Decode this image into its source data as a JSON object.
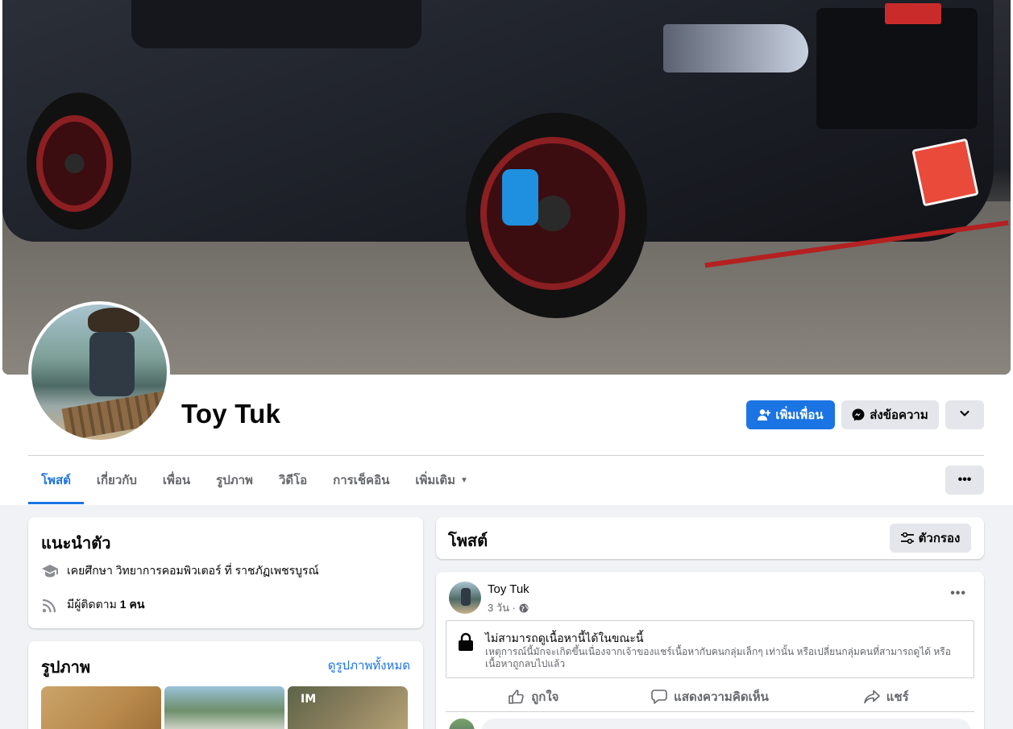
{
  "profile": {
    "name": "Toy Tuk",
    "add_friend_label": "เพิ่มเพื่อน",
    "message_label": "ส่งข้อความ"
  },
  "tabs": [
    {
      "label": "โพสต์",
      "active": true
    },
    {
      "label": "เกี่ยวกับ"
    },
    {
      "label": "เพื่อน"
    },
    {
      "label": "รูปภาพ"
    },
    {
      "label": "วิดีโอ"
    },
    {
      "label": "การเช็คอิน"
    },
    {
      "label": "เพิ่มเติม"
    }
  ],
  "intro": {
    "title": "แนะนำตัว",
    "education": "เคยศึกษา วิทยาการคอมพิวเตอร์ ที่ ราชภัฏเพชรบูรณ์",
    "followers_prefix": "มีผู้ติดตาม",
    "followers_count": "1 คน"
  },
  "photos": {
    "title": "รูปภาพ",
    "see_all": "ดูรูปภาพทั้งหมด",
    "thumb3_text": "IM"
  },
  "posts": {
    "title": "โพสต์",
    "filter_label": "ตัวกรอง"
  },
  "post": {
    "author": "Toy Tuk",
    "time": "3 วัน ·",
    "unavailable_title": "ไม่สามารถดูเนื้อหานี้ได้ในขณะนี้",
    "unavailable_desc": "เหตุการณ์นี้มักจะเกิดขึ้นเนื่องจากเจ้าของแชร์เนื้อหากับคนกลุ่มเล็กๆ เท่านั้น หรือเปลี่ยนกลุ่มคนที่สามารถดูได้ หรือเนื้อหาถูกลบไปแล้ว",
    "like_label": "ถูกใจ",
    "comment_label": "แสดงความคิดเห็น",
    "share_label": "แชร์"
  },
  "colors": {
    "accent": "#1b74e4",
    "background": "#f0f2f5",
    "button_gray": "#e4e6eb"
  },
  "icons": [
    "add-friend-icon",
    "messenger-icon",
    "chevron-down-icon",
    "more-icon",
    "graduation-cap-icon",
    "followers-icon",
    "filter-icon",
    "globe-icon",
    "lock-icon",
    "like-icon",
    "comment-icon",
    "share-icon"
  ]
}
